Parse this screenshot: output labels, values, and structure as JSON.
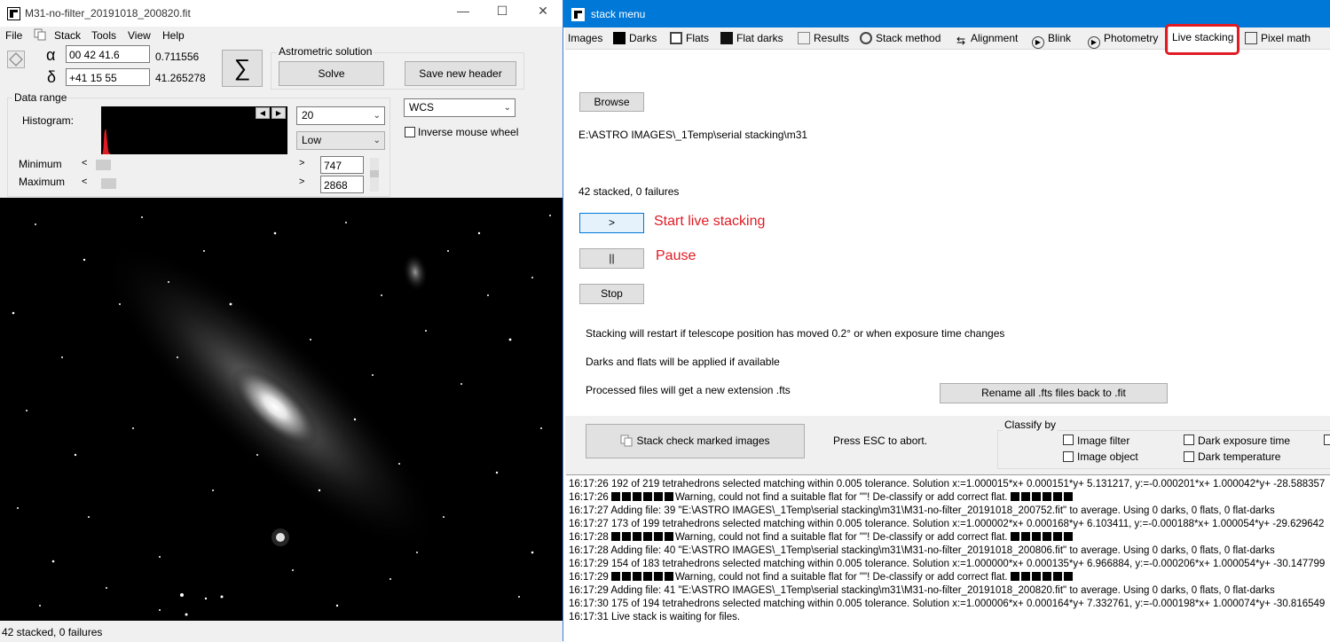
{
  "left_window": {
    "title": "M31-no-filter_20191018_200820.fit",
    "menu": [
      "File",
      "Stack",
      "Tools",
      "View",
      "Help"
    ],
    "alpha_symbol": "α",
    "delta_symbol": "δ",
    "ra_value": "00 42 41.6",
    "ra_decimal": "0.711556",
    "dec_value": "+41 15 55",
    "dec_decimal": "41.265278",
    "sigma_symbol": "∑",
    "astrometric_label": "Astrometric solution",
    "solve_label": "Solve",
    "save_header_label": "Save new header",
    "data_range_label": "Data range",
    "histogram_label": "Histogram:",
    "hist_select_value": "20",
    "level_select_value": "Low",
    "wcs_select_value": "WCS",
    "inverse_mouse_label": "Inverse mouse wheel",
    "minimum_label": "Minimum",
    "maximum_label": "Maximum",
    "min_value": "747",
    "max_value": "2868",
    "status": "42 stacked, 0 failures"
  },
  "right_window": {
    "title": "stack menu",
    "tabs": [
      "Images",
      "Darks",
      "Flats",
      "Flat darks",
      "Results",
      "Stack method",
      "Alignment",
      "Blink",
      "Photometry",
      "Live stacking",
      "Pixel math"
    ],
    "browse_label": "Browse",
    "path": "E:\\ASTRO IMAGES\\_1Temp\\serial stacking\\m31",
    "stacked_status": "42 stacked, 0 failures",
    "start_button": ">",
    "start_note": "Start live stacking",
    "pause_button": "||",
    "pause_note": "Pause",
    "stop_label": "Stop",
    "info_restart": "Stacking will restart if telescope position has moved  0.2° or when exposure time changes",
    "info_darks": "Darks and flats will be applied if available",
    "info_processed": "Processed files will get a new extension .fts",
    "rename_label": "Rename all .fts files back to .fit",
    "stack_check_label": "Stack check marked images",
    "press_esc": "Press ESC to abort.",
    "classify_by": "Classify by",
    "classify_options": [
      "Image filter",
      "Image object",
      "Dark exposure time",
      "Dark temperature"
    ],
    "log": [
      {
        "time": "16:17:26",
        "blocks": 0,
        "text": "192 of 219 tetrahedrons selected matching within 0.005 tolerance.  Solution x:=1.000015*x+ 0.000151*y+ 5.131217,  y:=-0.000201*x+ 1.000042*y+ -28.588357"
      },
      {
        "time": "16:17:26",
        "blocks": 6,
        "text": "Warning, could not find a suitable flat for \"\"! De-classify or add correct flat."
      },
      {
        "time": "16:17:27",
        "blocks": 0,
        "text": "Adding file: 39 \"E:\\ASTRO IMAGES\\_1Temp\\serial stacking\\m31\\M31-no-filter_20191018_200752.fit\"  to average. Using 0 darks, 0 flats, 0 flat-darks"
      },
      {
        "time": "16:17:27",
        "blocks": 0,
        "text": "173 of 199 tetrahedrons selected matching within 0.005 tolerance.  Solution x:=1.000002*x+ 0.000168*y+ 6.103411,  y:=-0.000188*x+ 1.000054*y+ -29.629642"
      },
      {
        "time": "16:17:28",
        "blocks": 6,
        "text": "Warning, could not find a suitable flat for \"\"! De-classify or add correct flat."
      },
      {
        "time": "16:17:28",
        "blocks": 0,
        "text": "Adding file: 40 \"E:\\ASTRO IMAGES\\_1Temp\\serial stacking\\m31\\M31-no-filter_20191018_200806.fit\"  to average. Using 0 darks, 0 flats, 0 flat-darks"
      },
      {
        "time": "16:17:29",
        "blocks": 0,
        "text": "154 of 183 tetrahedrons selected matching within 0.005 tolerance.  Solution x:=1.000000*x+ 0.000135*y+ 6.966884,  y:=-0.000206*x+ 1.000054*y+ -30.147799"
      },
      {
        "time": "16:17:29",
        "blocks": 6,
        "text": "Warning, could not find a suitable flat for \"\"! De-classify or add correct flat."
      },
      {
        "time": "16:17:29",
        "blocks": 0,
        "text": "Adding file: 41 \"E:\\ASTRO IMAGES\\_1Temp\\serial stacking\\m31\\M31-no-filter_20191018_200820.fit\"  to average. Using 0 darks, 0 flats, 0 flat-darks"
      },
      {
        "time": "16:17:30",
        "blocks": 0,
        "text": "175 of 194 tetrahedrons selected matching within 0.005 tolerance.  Solution x:=1.000006*x+ 0.000164*y+ 7.332761,  y:=-0.000198*x+ 1.000074*y+ -30.816549"
      },
      {
        "time": "16:17:31",
        "blocks": 0,
        "text": "Live stack is waiting for files."
      }
    ]
  },
  "colors": {
    "accent": "#0078d7",
    "highlight": "#e01b24"
  }
}
